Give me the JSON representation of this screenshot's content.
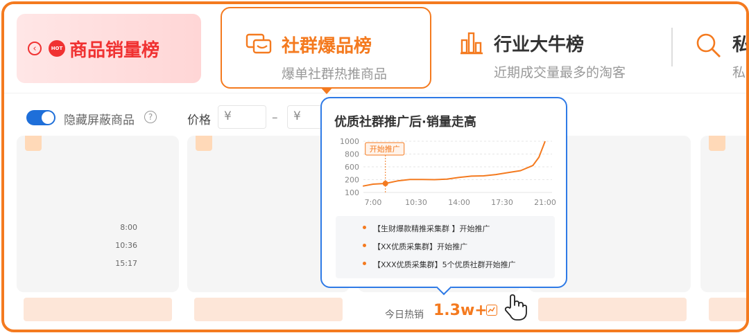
{
  "tabs": {
    "back": {
      "title": "商品销量榜",
      "hot_badge": "HOT",
      "back_icon": "‹"
    },
    "active": {
      "title": "社群爆品榜",
      "subtitle": "爆单社群热推商品"
    },
    "industry": {
      "title": "行业大牛榜",
      "subtitle": "近期成交量最多的淘客"
    },
    "search_partial": {
      "title": "私",
      "subtitle": "私"
    }
  },
  "filters": {
    "hide_blocked_label": "隐藏屏蔽商品",
    "hide_blocked_on": true,
    "help_icon": "?",
    "price_label": "价格",
    "currency_symbol_min": "¥",
    "currency_symbol_max": "¥",
    "range_dash": "–"
  },
  "popup": {
    "title": "优质社群推广后·销量走高",
    "events": [
      {
        "time": "8:00",
        "text": "【生财爆款精推采集群 】开始推广"
      },
      {
        "time": "10:36",
        "text": "【XX优质采集群】开始推广"
      },
      {
        "time": "15:17",
        "text": "【XXX优质采集群】5个优质社群开始推广"
      }
    ]
  },
  "chart_data": {
    "type": "line",
    "title": "",
    "y_ticks": [
      1000,
      800,
      600,
      200,
      100
    ],
    "x_ticks": [
      "7:00",
      "10:30",
      "14:00",
      "17:30",
      "21:00"
    ],
    "annotation": {
      "label": "开始推广",
      "x": "8:00",
      "y": 170
    },
    "series": [
      {
        "x": [
          "6:10",
          "7:00",
          "8:00",
          "9:00",
          "10:00",
          "11:00",
          "12:00",
          "13:00",
          "14:00",
          "15:00",
          "16:00",
          "17:00",
          "18:00",
          "19:00",
          "20:00",
          "20:30",
          "21:00"
        ],
        "y": [
          150,
          165,
          170,
          190,
          205,
          205,
          200,
          215,
          270,
          310,
          320,
          360,
          420,
          480,
          620,
          750,
          1000
        ]
      }
    ],
    "colors": {
      "line": "#f47a1f",
      "annotation": "#f47a1f"
    }
  },
  "sales": {
    "label": "今日热销",
    "value": "1.3w+"
  },
  "colors": {
    "accent": "#f47a1f",
    "red": "#f03232",
    "blue": "#2e7ae6"
  }
}
